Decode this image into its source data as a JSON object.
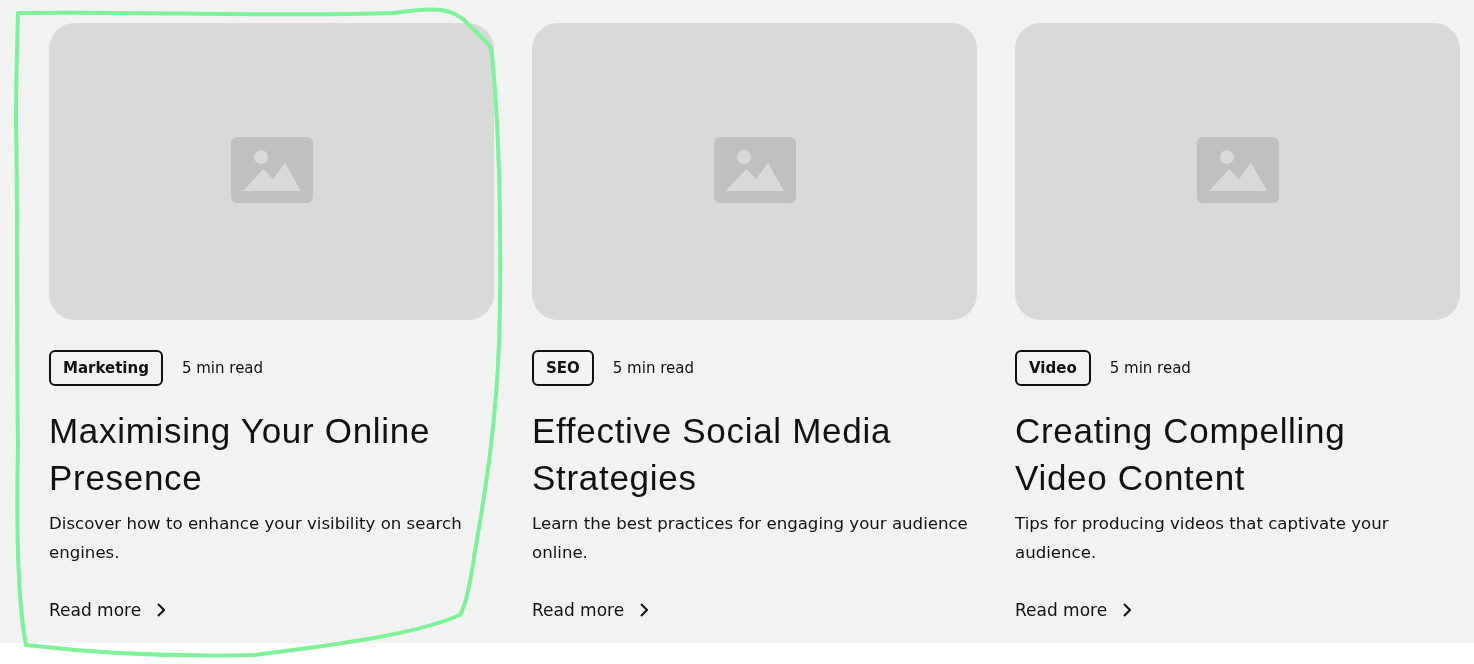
{
  "cards": [
    {
      "tag": "Marketing",
      "read_time": "5 min read",
      "title": "Maximising Your Online Presence",
      "description": "Discover how to enhance your visibility on search engines.",
      "link": "Read more",
      "highlighted": true
    },
    {
      "tag": "SEO",
      "read_time": "5 min read",
      "title": "Effective Social Media Strategies",
      "description": "Learn the best practices for engaging your audience online.",
      "link": "Read more",
      "highlighted": false
    },
    {
      "tag": "Video",
      "read_time": "5 min read",
      "title": "Creating Compelling Video Content",
      "description": "Tips for producing videos that captivate your audience.",
      "link": "Read more",
      "highlighted": false
    }
  ]
}
